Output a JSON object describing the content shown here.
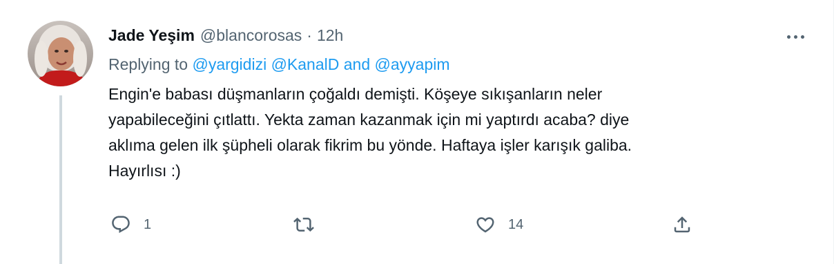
{
  "tweet": {
    "display_name": "Jade Yeşim",
    "handle": "@blancorosas",
    "separator": "·",
    "time": "12h",
    "replying_prefix": "Replying to",
    "mentions": [
      "@yargidizi",
      "@KanalD",
      "@ayyapim"
    ],
    "mention_joiner": "and",
    "text_lines": [
      "Engin'e babası düşmanların çoğaldı demişti. Köşeye sıkışanların neler",
      "yapabileceğini çıtlattı. Yekta zaman kazanmak için mi yaptırdı acaba? diye",
      "aklıma gelen ilk şüpheli olarak fikrim bu yönde. Haftaya işler karışık galiba.",
      "Hayırlısı :)"
    ],
    "actions": {
      "reply_count": "1",
      "retweet_count": "",
      "like_count": "14",
      "share_count": ""
    },
    "icons": {
      "reply": "reply-icon",
      "retweet": "retweet-icon",
      "like": "heart-icon",
      "share": "share-icon",
      "more": "more-icon"
    },
    "colors": {
      "text": "#0f1419",
      "secondary": "#536471",
      "link": "#1d9bf0",
      "thread_line": "#cfd9de"
    }
  }
}
